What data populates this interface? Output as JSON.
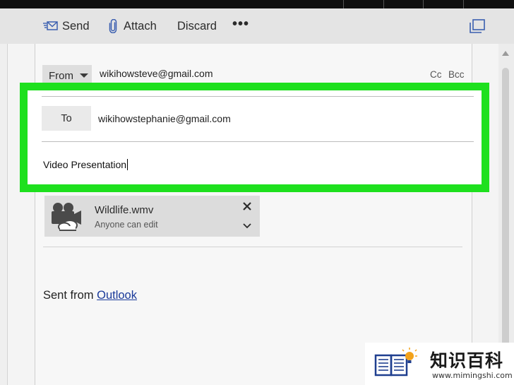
{
  "toolbar": {
    "send_label": "Send",
    "attach_label": "Attach",
    "discard_label": "Discard",
    "more_label": "•••"
  },
  "header": {
    "from_label": "From",
    "from_address": "wikihowsteve@gmail.com",
    "cc_label": "Cc",
    "bcc_label": "Bcc",
    "to_label": "To",
    "to_address": "wikihowstephanie@gmail.com",
    "subject": "Video Presentation"
  },
  "attachment": {
    "file_name": "Wildlife.wmv",
    "permission": "Anyone can edit"
  },
  "body": {
    "signature_prefix": "Sent from ",
    "signature_link": "Outlook"
  },
  "watermark": {
    "title": "知识百科",
    "url": "www.mimingshi.com"
  },
  "icons": {
    "send": "send-icon",
    "attach": "paperclip-icon",
    "popout": "popout-icon",
    "from_dropdown": "chevron-down-icon",
    "attachment_type": "video-camera-cloud-icon",
    "remove_attachment": "close-icon",
    "expand_attachment": "chevron-down-icon"
  },
  "colors": {
    "highlight": "#1ee01e",
    "link": "#1a3a9a",
    "toolbar_bg": "#e4e4e4"
  }
}
